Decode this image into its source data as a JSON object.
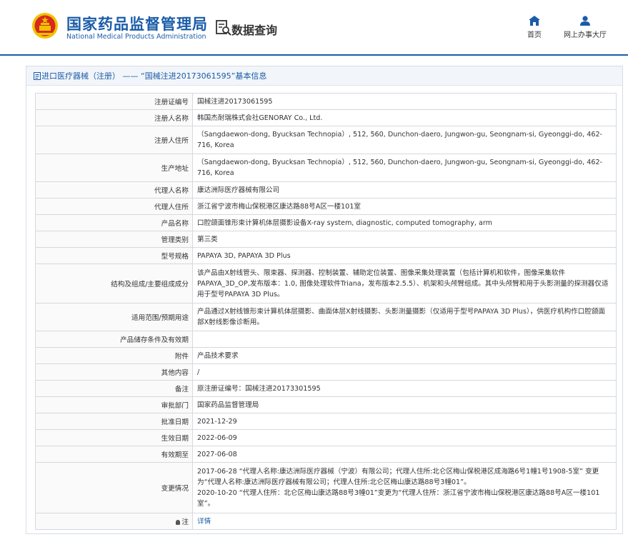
{
  "header": {
    "logo_cn": "国家药品监督管理局",
    "logo_en": "National Medical Products Administration",
    "query_label": "数据查询",
    "nav": {
      "home_label": "首页",
      "hall_label": "网上办事大厅"
    }
  },
  "panel": {
    "title": "进口医疗器械（注册） —— “国械注进20173061595”基本信息"
  },
  "rows": [
    {
      "label": "注册证编号",
      "value": "国械注进20173061595"
    },
    {
      "label": "注册人名称",
      "value": "韩国杰耐瑞株式会社GENORAY Co., Ltd."
    },
    {
      "label": "注册人住所",
      "value": "（Sangdaewon-dong, Byucksan Technopia）, 512, 560, Dunchon-daero, Jungwon-gu, Seongnam-si, Gyeonggi-do, 462-716, Korea"
    },
    {
      "label": "生产地址",
      "value": "（Sangdaewon-dong, Byucksan Technopia）, 512, 560, Dunchon-daero, Jungwon-gu, Seongnam-si, Gyeonggi-do, 462-716, Korea"
    },
    {
      "label": "代理人名称",
      "value": "康达洲际医疗器械有限公司"
    },
    {
      "label": "代理人住所",
      "value": "浙江省宁波市梅山保税港区康达路88号A区一楼101室"
    },
    {
      "label": "产品名称",
      "value": "口腔颌面锥形束计算机体层摄影设备X-ray system, diagnostic, computed tomography, arm"
    },
    {
      "label": "管理类别",
      "value": "第三类"
    },
    {
      "label": "型号规格",
      "value": "PAPAYA 3D, PAPAYA 3D Plus"
    },
    {
      "label": "结构及组成/主要组成成分",
      "value": "该产品由X射线管头、限束器、探测器、控制装置、辅助定位装置、图像采集处理装置（包括计算机和软件，图像采集软件PAPAYA_3D_OP,发布版本：1.0, 图像处理软件Triana，发布版本2.5.5）、机架和头颅臂组成。其中头颅臂和用于头影测量的探测器仅适用于型号PAPAYA 3D Plus。"
    },
    {
      "label": "适用范围/预期用途",
      "value": "产品通过X射线锥形束计算机体层摄影、曲面体层X射线摄影、头影测量摄影（仅适用于型号PAPAYA 3D Plus），供医疗机构作口腔颌面部X射线影像诊断用。"
    },
    {
      "label": "产品储存条件及有效期",
      "value": ""
    },
    {
      "label": "附件",
      "value": "产品技术要求"
    },
    {
      "label": "其他内容",
      "value": "/"
    },
    {
      "label": "备注",
      "value": "原注册证编号：国械注进20173301595"
    },
    {
      "label": "审批部门",
      "value": "国家药品监督管理局"
    },
    {
      "label": "批准日期",
      "value": "2021-12-29"
    },
    {
      "label": "生效日期",
      "value": "2022-06-09"
    },
    {
      "label": "有效期至",
      "value": "2027-06-08"
    },
    {
      "label": "变更情况",
      "value": "2017-06-28 “代理人名称:康达洲际医疗器械（宁波）有限公司；代理人住所:北仑区梅山保税港区成海路6号1幢1号1908-5室” 变更为“代理人名称:康达洲际医疗器械有限公司；代理人住所:北仑区梅山康达路88号3幢01”。\n2020-10-20 “代理人住所：北仑区梅山康达路88号3幢01”变更为“代理人住所：浙江省宁波市梅山保税港区康达路88号A区一楼101室”。"
    },
    {
      "label": "注",
      "value": "详情"
    }
  ],
  "colors": {
    "brand": "#1a5ca8",
    "emblem_red": "#d52b1e",
    "emblem_gold": "#f2c200"
  }
}
